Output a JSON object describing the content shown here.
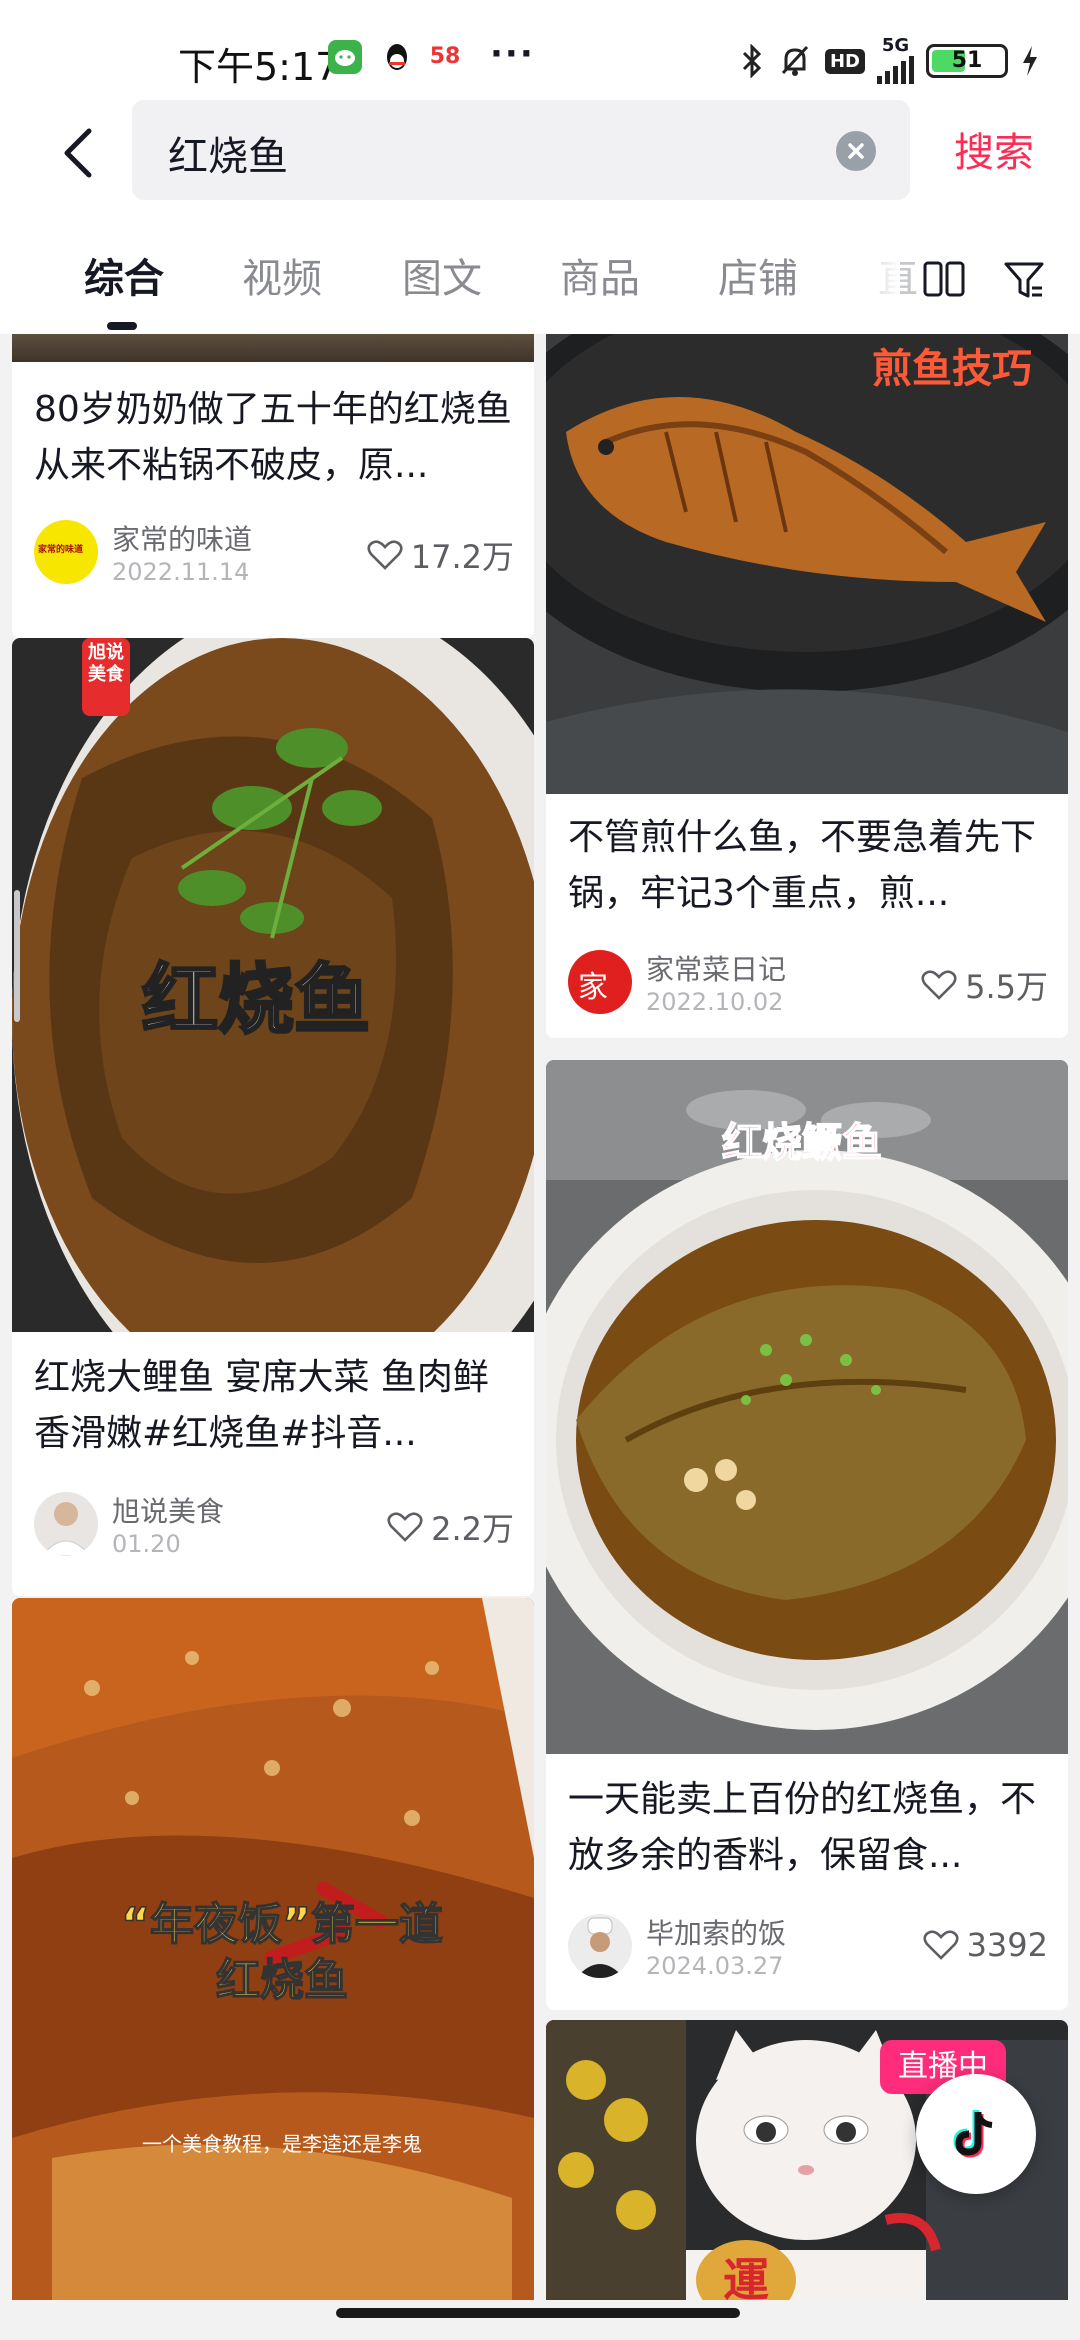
{
  "status_bar": {
    "time": "下午5:17",
    "app_icon_58": "58",
    "network": "5G",
    "hd": "HD",
    "battery_percent": 51,
    "battery_label": "51"
  },
  "search": {
    "query": "红烧鱼",
    "submit_label": "搜索"
  },
  "tabs": [
    {
      "label": "综合",
      "active": true
    },
    {
      "label": "视频"
    },
    {
      "label": "图文"
    },
    {
      "label": "商品"
    },
    {
      "label": "店铺"
    },
    {
      "label": "直"
    }
  ],
  "feed": {
    "left": [
      {
        "title": "80岁奶奶做了五十年的红烧鱼从来不粘锅不破皮，原...",
        "author": "家常的味道",
        "date": "2022.11.14",
        "likes": "17.2万",
        "avatar_text": "家常的味道"
      },
      {
        "overlay": "红烧鱼",
        "tag": "旭说美食",
        "title": "红烧大鲤鱼 宴席大菜 鱼肉鲜香滑嫩#红烧鱼#抖音...",
        "author": "旭说美食",
        "date": "01.20",
        "likes": "2.2万"
      },
      {
        "overlay_line1": "“年夜饭”第一道",
        "overlay_line2": "红烧鱼",
        "caption": "一个美食教程，是李逵还是李鬼"
      }
    ],
    "right": [
      {
        "overlay": "煎鱼技巧",
        "title": "不管煎什么鱼，不要急着先下锅，牢记3个重点，煎...",
        "author": "家常菜日记",
        "date": "2022.10.02",
        "likes": "5.5万",
        "avatar_text": "家"
      },
      {
        "overlay": "红烧鳜鱼",
        "title": "一天能卖上百份的红烧鱼，不放多余的香料，保留食...",
        "author": "毕加索的饭",
        "date": "2024.03.27",
        "likes": "3392"
      },
      {
        "badge": "直播中",
        "figurine_text": "運"
      }
    ]
  },
  "colors": {
    "accent": "#fe2c55",
    "text_primary": "#161823",
    "text_secondary": "#8a8b91"
  }
}
